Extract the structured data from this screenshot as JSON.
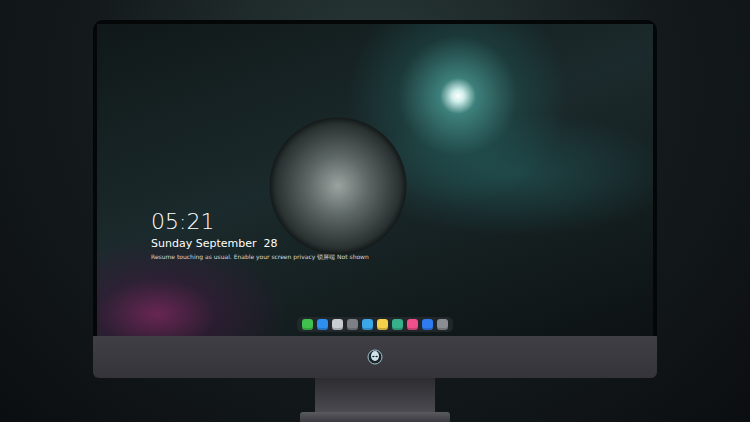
{
  "lock_screen": {
    "time": "05:21",
    "date": "Sunday September  28",
    "notice": "Resume touching as usual. Enable your screen privacy 锁屏端 Not shown"
  },
  "dock": {
    "items": [
      {
        "color": "#3fc24e"
      },
      {
        "color": "#2f8ff0"
      },
      {
        "color": "#c9ccd1"
      },
      {
        "color": "#7d8187"
      },
      {
        "color": "#3aa8e8"
      },
      {
        "color": "#f5d04a"
      },
      {
        "color": "#35b28c"
      },
      {
        "color": "#ef4f8a"
      },
      {
        "color": "#2f7cf2"
      },
      {
        "color": "#8a8d93"
      }
    ]
  }
}
